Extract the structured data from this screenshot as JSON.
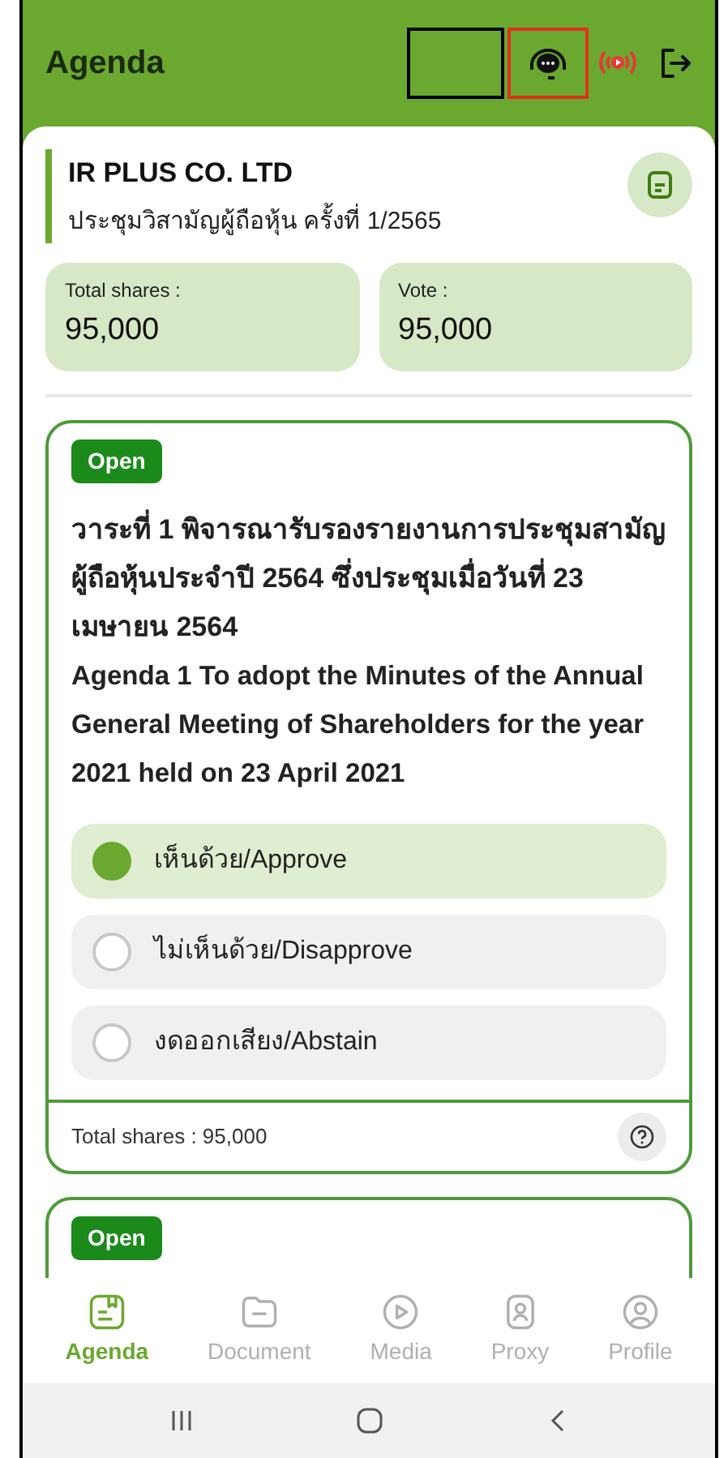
{
  "header": {
    "title": "Agenda"
  },
  "company": {
    "name": "IR PLUS CO. LTD",
    "meeting": "ประชุมวิสามัญผู้ถือหุ้น ครั้งที่ 1/2565"
  },
  "stats": [
    {
      "label": "Total shares :",
      "value": "95,000"
    },
    {
      "label": "Vote :",
      "value": "95,000"
    }
  ],
  "agendas": [
    {
      "status": "Open",
      "title_th": "วาระที่ 1 พิจารณารับรองรายงานการประชุมสามัญผู้ถือหุ้นประจำปี 2564 ซึ่งประชุมเมื่อวันที่ 23 เมษายน 2564",
      "title_en": "Agenda 1 To adopt the Minutes of the Annual General Meeting of Shareholders for the year 2021 held on 23 April 2021",
      "options": [
        {
          "label": "เห็นด้วย/Approve",
          "selected": true
        },
        {
          "label": "ไม่เห็นด้วย/Disapprove",
          "selected": false
        },
        {
          "label": "งดออกเสียง/Abstain",
          "selected": false
        }
      ],
      "footer": "Total shares : 95,000"
    },
    {
      "status": "Open"
    }
  ],
  "bottom_nav": [
    {
      "label": "Agenda",
      "selected": true
    },
    {
      "label": "Document",
      "selected": false
    },
    {
      "label": "Media",
      "selected": false
    },
    {
      "label": "Proxy",
      "selected": false
    },
    {
      "label": "Profile",
      "selected": false
    }
  ]
}
